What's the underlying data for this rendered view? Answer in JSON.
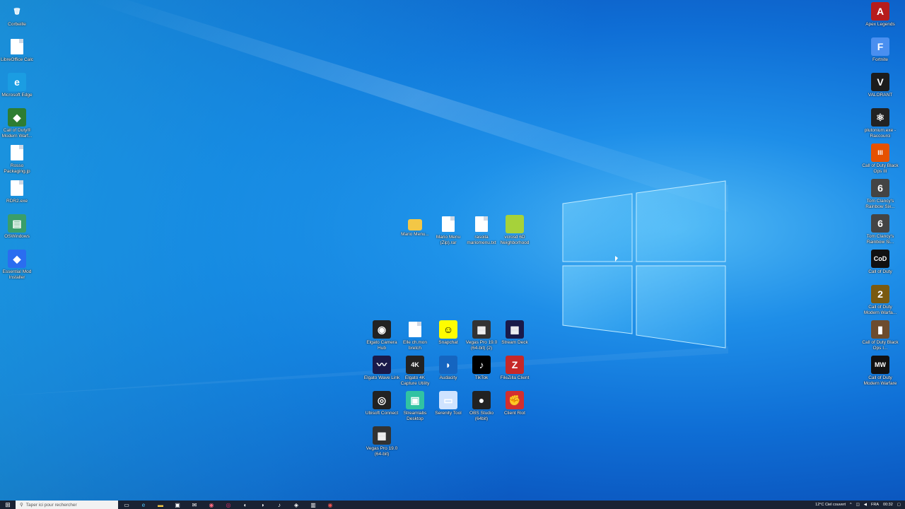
{
  "desktop": {
    "left_icons": [
      {
        "label": "Corbeille",
        "name": "recycle-bin",
        "glyph": "🗑",
        "bg": "transparent"
      },
      {
        "label": "LibreOffice Calc",
        "name": "libreoffice-calc",
        "glyph": "",
        "bg": "file"
      },
      {
        "label": "Microsoft Edge",
        "name": "microsoft-edge",
        "glyph": "e",
        "bg": "#1b9de2"
      },
      {
        "label": "Call of Duty® Modern Warf...",
        "name": "call-of-duty-modern-warfare-shortcut",
        "glyph": "◆",
        "bg": "#2e7d32"
      },
      {
        "label": "Rosso Packaging.jp",
        "name": "rosso-packaging-file",
        "glyph": "",
        "bg": "file"
      },
      {
        "label": "RDR2.exe",
        "name": "rdr2-file",
        "glyph": "",
        "bg": "file"
      },
      {
        "label": "OSWindows",
        "name": "oswindows",
        "glyph": "▤",
        "bg": "#3a9e6a"
      },
      {
        "label": "Essential Mod Installer",
        "name": "essential-mod-installer",
        "glyph": "◆",
        "bg": "#2a6df0"
      }
    ],
    "center_top_icons": [
      {
        "label": "Mario Menu...",
        "name": "mario-menu-folder",
        "glyph": "",
        "bg": "folder"
      },
      {
        "label": "Mario Menu (Zip).rar",
        "name": "mario-menu-zip",
        "glyph": "",
        "bg": "file"
      },
      {
        "label": "rasoila mariomenu.txt",
        "name": "mariomenu-text",
        "glyph": "",
        "bg": "file"
      },
      {
        "label": "vcrosd 6D Neighborhood",
        "name": "neighborhood-image",
        "glyph": "",
        "bg": "#a6d23a"
      }
    ],
    "center_grid_icons": [
      {
        "label": "Elgato Camera Hub",
        "name": "elgato-camera-hub",
        "glyph": "◉",
        "bg": "#222"
      },
      {
        "label": "Elle ch.mon bretch",
        "name": "text-document",
        "glyph": "",
        "bg": "file"
      },
      {
        "label": "Snapchat",
        "name": "snapchat",
        "glyph": "☺",
        "bg": "#fffc00"
      },
      {
        "label": "Vegas Pro 19.0 (64-bit) (2)",
        "name": "vegas-pro-19-2",
        "glyph": "▦",
        "bg": "#333"
      },
      {
        "label": "Stream Deck",
        "name": "stream-deck",
        "glyph": "▦",
        "bg": "#1a1a4a"
      },
      {
        "label": "Elgato Wave Link",
        "name": "elgato-wave-link",
        "glyph": "〰",
        "bg": "#1a1a4a"
      },
      {
        "label": "Elgato 4K Capture Utility",
        "name": "elgato-4k-capture",
        "glyph": "4K",
        "bg": "#222"
      },
      {
        "label": "Audacity",
        "name": "audacity",
        "glyph": "◗",
        "bg": "#1565c0"
      },
      {
        "label": "TikTok",
        "name": "tiktok",
        "glyph": "♪",
        "bg": "#000"
      },
      {
        "label": "FileZilla Client",
        "name": "filezilla",
        "glyph": "Z",
        "bg": "#c62828"
      },
      {
        "label": "Ubisoft Connect",
        "name": "ubisoft-connect",
        "glyph": "◎",
        "bg": "#222"
      },
      {
        "label": "Streamlabs Desktop",
        "name": "streamlabs-desktop",
        "glyph": "▣",
        "bg": "#31c3a2"
      },
      {
        "label": "Serenity Tool",
        "name": "serenity-tool",
        "glyph": "▭",
        "bg": "#cfe3ff"
      },
      {
        "label": "OBS Studio (64bit)",
        "name": "obs-studio",
        "glyph": "●",
        "bg": "#222"
      },
      {
        "label": "Client Riot",
        "name": "riot-client",
        "glyph": "✊",
        "bg": "#d32f2f"
      },
      {
        "label": "Vegas Pro 19.0 (64-bit)",
        "name": "vegas-pro-19",
        "glyph": "▦",
        "bg": "#333"
      }
    ],
    "right_icons": [
      {
        "label": "Apex Legends",
        "name": "apex-legends",
        "glyph": "A",
        "bg": "#b71c1c"
      },
      {
        "label": "Fortnite",
        "name": "fortnite",
        "glyph": "F",
        "bg": "#4a8ff0"
      },
      {
        "label": "VALORANT",
        "name": "valorant",
        "glyph": "V",
        "bg": "#1c1c1c"
      },
      {
        "label": "plutonium.exe - Raccourci",
        "name": "plutonium",
        "glyph": "⚛",
        "bg": "#222"
      },
      {
        "label": "Call of Duty Black Ops III",
        "name": "black-ops-3",
        "glyph": "III",
        "bg": "#e65100"
      },
      {
        "label": "Tom Clancy's Rainbow Six...",
        "name": "rainbow-six-1",
        "glyph": "6",
        "bg": "#444"
      },
      {
        "label": "Tom Clancy's Rainbow Si...",
        "name": "rainbow-six-2",
        "glyph": "6",
        "bg": "#444"
      },
      {
        "label": "Call of Duty",
        "name": "call-of-duty",
        "glyph": "CoD",
        "bg": "#111"
      },
      {
        "label": "Call of Duty Modern Warfa...",
        "name": "modern-warfare-2",
        "glyph": "2",
        "bg": "#7a5a10"
      },
      {
        "label": "Call of Duty Black Ops I...",
        "name": "black-ops-1",
        "glyph": "▮",
        "bg": "#6d4c2e"
      },
      {
        "label": "Call of Duty Modern Warfare",
        "name": "modern-warfare",
        "glyph": "MW",
        "bg": "#111"
      }
    ]
  },
  "taskbar": {
    "search_placeholder": "Taper ici pour rechercher",
    "weather": "12°C  Ciel couvert",
    "lang": "FRA",
    "time": "00:32",
    "date": "—"
  }
}
